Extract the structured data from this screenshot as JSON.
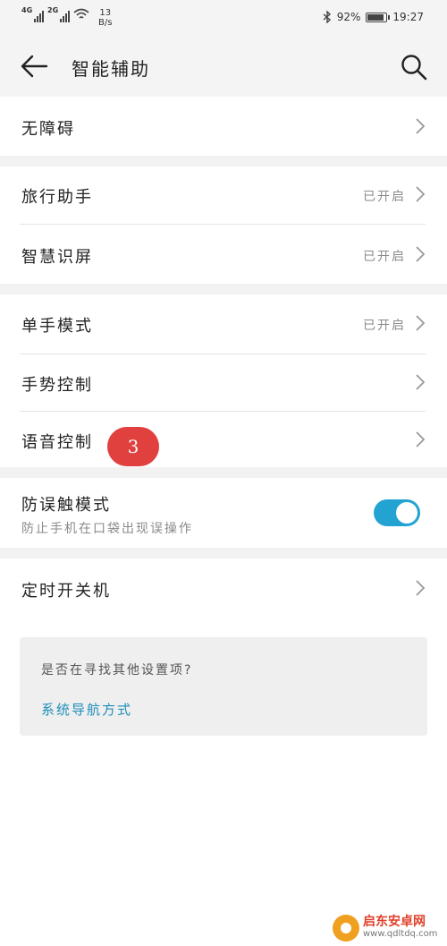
{
  "status_bar": {
    "signal1": "4G",
    "signal2": "2G",
    "net_speed_value": "13",
    "net_speed_unit": "B/s",
    "battery_percent": "92%",
    "battery_level": 0.92,
    "time": "19:27"
  },
  "header": {
    "title": "智能辅助",
    "back_icon": "arrow-left-icon",
    "search_icon": "search-icon"
  },
  "items": {
    "accessibility": {
      "label": "无障碍"
    },
    "travel_assistant": {
      "label": "旅行助手",
      "status": "已开启"
    },
    "smart_screen": {
      "label": "智慧识屏",
      "status": "已开启"
    },
    "one_hand": {
      "label": "单手模式",
      "status": "已开启"
    },
    "gesture": {
      "label": "手势控制"
    },
    "voice": {
      "label": "语音控制"
    },
    "pocket_mode": {
      "label": "防误触模式",
      "sublabel": "防止手机在口袋出现误操作",
      "enabled": true
    },
    "scheduled_power": {
      "label": "定时开关机"
    }
  },
  "annotation": {
    "step": "3",
    "color": "#e0403e"
  },
  "suggestion": {
    "question": "是否在寻找其他设置项?",
    "link": "系统导航方式"
  },
  "watermark": {
    "name": "启东安卓网",
    "url": "www.qdltdq.com"
  },
  "colors": {
    "accent": "#23a3d1",
    "link": "#1e8fb8",
    "section_gap": "#f2f2f2"
  }
}
